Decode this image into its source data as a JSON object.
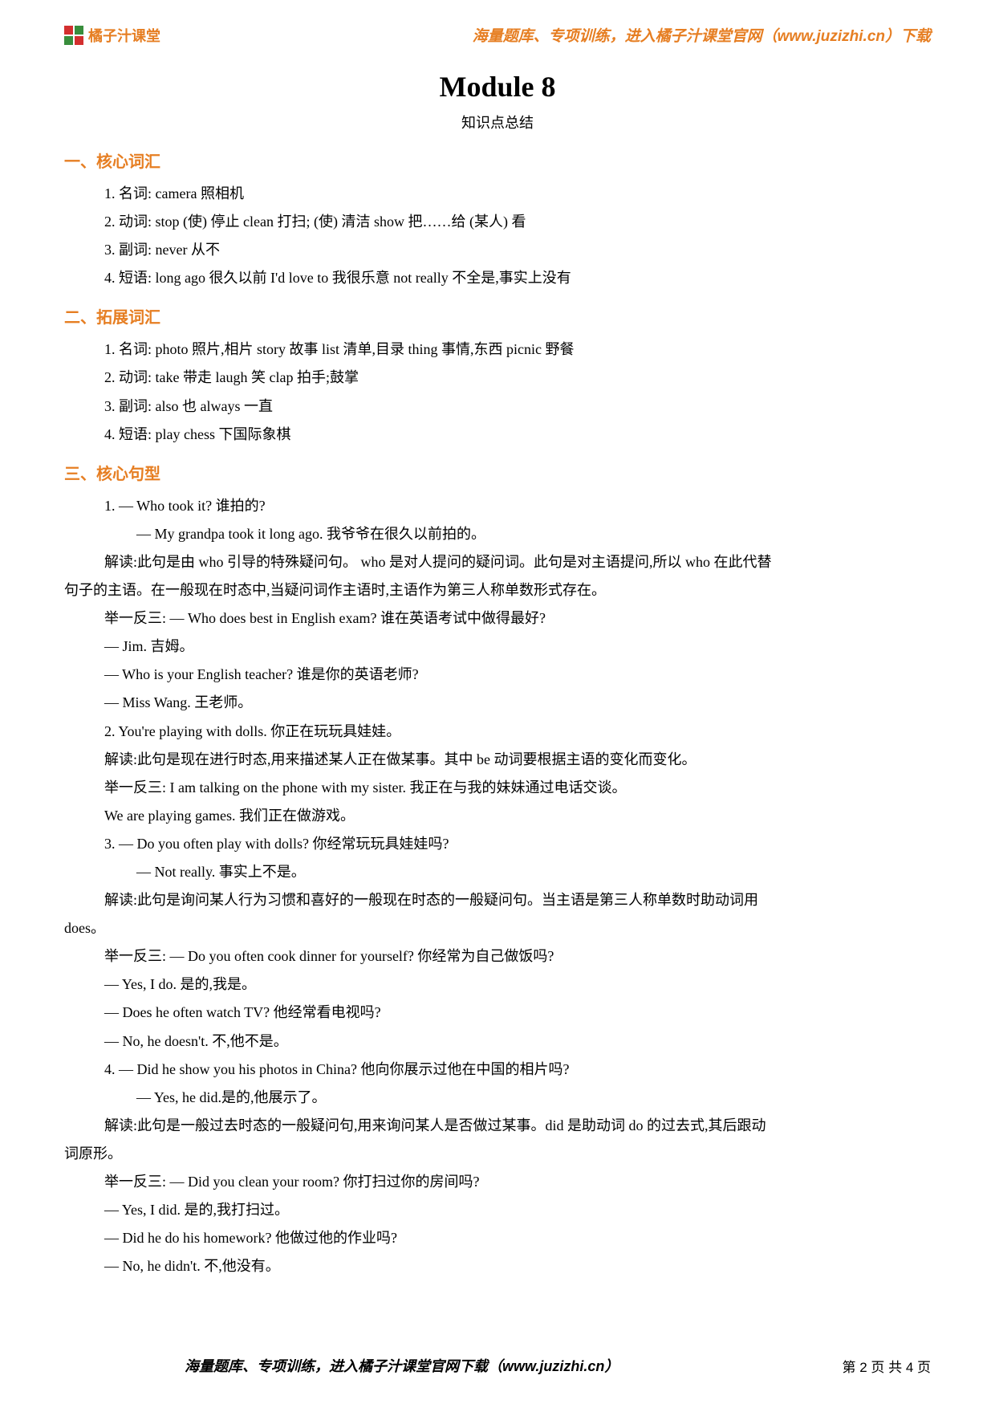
{
  "header": {
    "logo_text": "橘子汁课堂",
    "banner": "海量题库、专项训练，进入橘子汁课堂官网（www.juzizhi.cn）下载"
  },
  "title": "Module 8",
  "subtitle": "知识点总结",
  "sections": {
    "s1": {
      "heading": "一、核心词汇",
      "lines": [
        "1. 名词: camera 照相机",
        "2. 动词: stop (使) 停止   clean 打扫; (使) 清洁   show 把……给 (某人) 看",
        "3. 副词: never 从不",
        "4. 短语: long ago 很久以前   I'd love to 我很乐意   not really 不全是,事实上没有"
      ]
    },
    "s2": {
      "heading": "二、拓展词汇",
      "lines": [
        "1. 名词: photo 照片,相片   story 故事   list 清单,目录   thing 事情,东西   picnic 野餐",
        "2. 动词: take 带走   laugh 笑   clap 拍手;鼓掌",
        "3. 副词: also 也   always 一直",
        "4. 短语: play chess 下国际象棋"
      ]
    },
    "s3": {
      "heading": "三、核心句型",
      "q1": "1. — Who took it? 谁拍的?",
      "a1": "— My grandpa took it long ago. 我爷爷在很久以前拍的。",
      "ex1a": "解读:此句是由 who 引导的特殊疑问句。 who 是对人提问的疑问词。此句是对主语提问,所以 who 在此代替",
      "ex1b": "句子的主语。在一般现在时态中,当疑问词作主语时,主语作为第三人称单数形式存在。",
      "ex1c": "举一反三: — Who does best in English exam? 谁在英语考试中做得最好?",
      "ex1d": "— Jim. 吉姆。",
      "ex1e": "— Who is your English teacher? 谁是你的英语老师?",
      "ex1f": "— Miss Wang. 王老师。",
      "q2": "2. You're playing with dolls. 你正在玩玩具娃娃。",
      "ex2a": "解读:此句是现在进行时态,用来描述某人正在做某事。其中 be 动词要根据主语的变化而变化。",
      "ex2b": "举一反三: I am talking on the phone with my sister. 我正在与我的妹妹通过电话交谈。",
      "ex2c": "We are playing games. 我们正在做游戏。",
      "q3": "3. — Do you often play with dolls? 你经常玩玩具娃娃吗?",
      "a3": "— Not really. 事实上不是。",
      "ex3a": "解读:此句是询问某人行为习惯和喜好的一般现在时态的一般疑问句。当主语是第三人称单数时助动词用",
      "ex3b": "does。",
      "ex3c": "举一反三: — Do you often cook dinner for yourself? 你经常为自己做饭吗?",
      "ex3d": "— Yes, I do. 是的,我是。",
      "ex3e": "— Does he often watch TV? 他经常看电视吗?",
      "ex3f": "— No, he doesn't. 不,他不是。",
      "q4": "4. — Did he show you his photos in China? 他向你展示过他在中国的相片吗?",
      "a4": "— Yes, he did.是的,他展示了。",
      "ex4a": "解读:此句是一般过去时态的一般疑问句,用来询问某人是否做过某事。did 是助动词 do 的过去式,其后跟动",
      "ex4b": "词原形。",
      "ex4c": "举一反三: — Did you clean your room? 你打扫过你的房间吗?",
      "ex4d": "— Yes, I did. 是的,我打扫过。",
      "ex4e": "— Did he do his homework? 他做过他的作业吗?",
      "ex4f": "— No, he didn't. 不,他没有。"
    }
  },
  "footer": {
    "center": "海量题库、专项训练，进入橘子汁课堂官网下载（www.juzizhi.cn）",
    "right": "第 2 页 共 4 页"
  }
}
